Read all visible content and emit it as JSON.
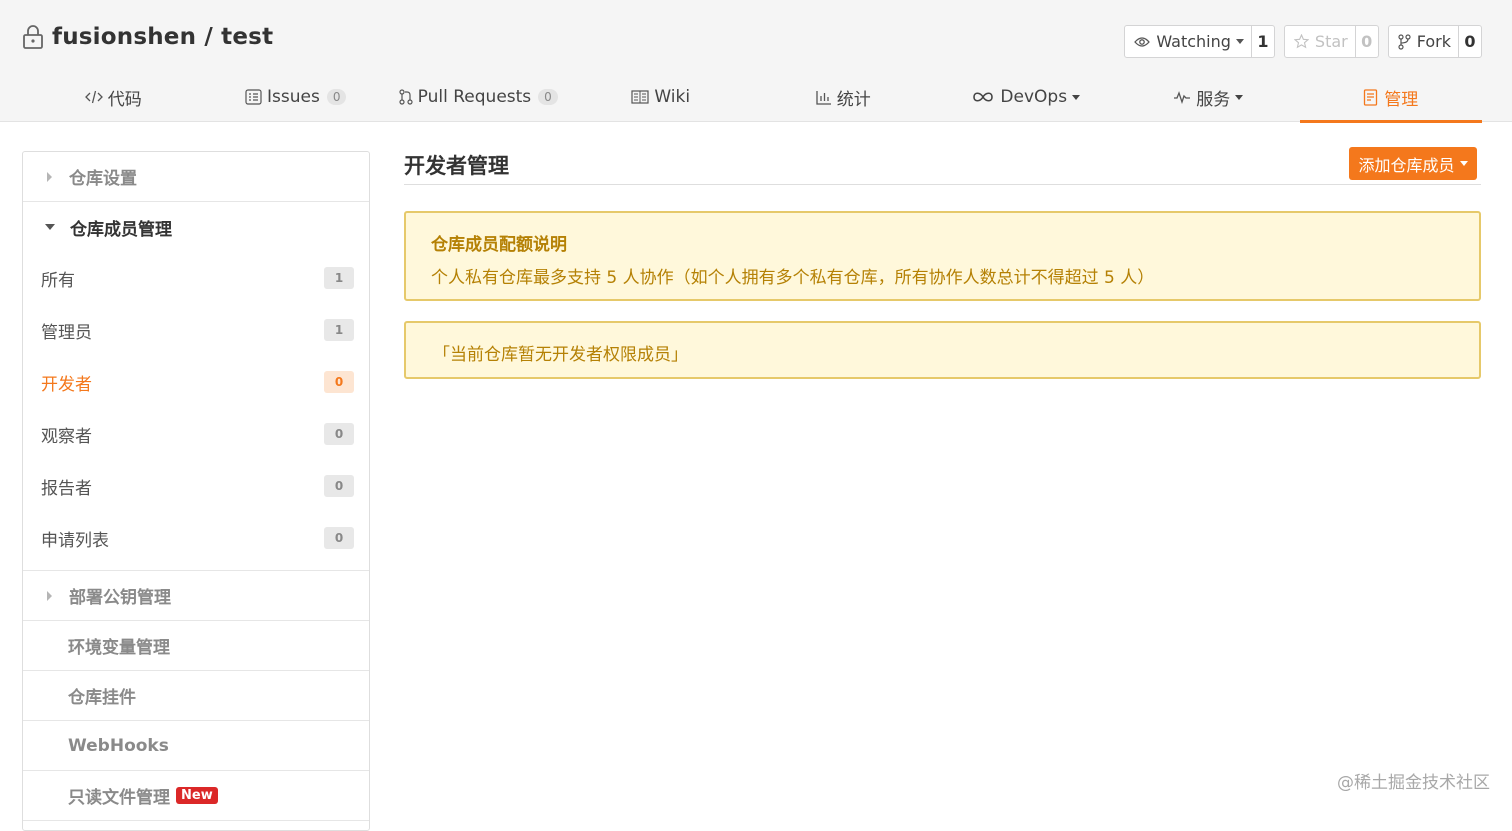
{
  "repo": {
    "owner_repo": "fusionshen / test"
  },
  "actions": {
    "watch": {
      "label": "Watching",
      "count": "1"
    },
    "star": {
      "label": "Star",
      "count": "0"
    },
    "fork": {
      "label": "Fork",
      "count": "0"
    }
  },
  "tabs": [
    {
      "label": "代码",
      "icon": "code-icon"
    },
    {
      "label": "Issues",
      "badge": "0",
      "icon": "issue-icon"
    },
    {
      "label": "Pull Requests",
      "badge": "0",
      "icon": "pull-request-icon"
    },
    {
      "label": "Wiki",
      "icon": "book-icon"
    },
    {
      "label": "统计",
      "icon": "bar-chart-icon"
    },
    {
      "label": "DevOps",
      "icon": "infinity-icon"
    },
    {
      "label": "服务",
      "icon": "pulse-icon"
    },
    {
      "label": "管理",
      "icon": "manage-icon"
    }
  ],
  "sidebar": {
    "repo_settings": "仓库设置",
    "members": "仓库成员管理",
    "items": [
      {
        "label": "所有",
        "count": "1"
      },
      {
        "label": "管理员",
        "count": "1"
      },
      {
        "label": "开发者",
        "count": "0"
      },
      {
        "label": "观察者",
        "count": "0"
      },
      {
        "label": "报告者",
        "count": "0"
      },
      {
        "label": "申请列表",
        "count": "0"
      }
    ],
    "deploy_keys": "部署公钥管理",
    "env_vars": "环境变量管理",
    "plugins": "仓库挂件",
    "webhooks": "WebHooks",
    "readonly_files": "只读文件管理",
    "new_badge": "New"
  },
  "main": {
    "title": "开发者管理",
    "add_button": "添加仓库成员",
    "quota_title": "仓库成员配额说明",
    "quota_body": "个人私有仓库最多支持 5 人协作（如个人拥有多个私有仓库，所有协作人数总计不得超过 5 人）",
    "empty_notice": "「当前仓库暂无开发者权限成员」"
  },
  "watermark": "@稀土掘金技术社区",
  "colors": {
    "accent": "#f4781c",
    "notice_bg": "#fff8db",
    "notice_text": "#b58105",
    "new_badge": "#db2828"
  }
}
